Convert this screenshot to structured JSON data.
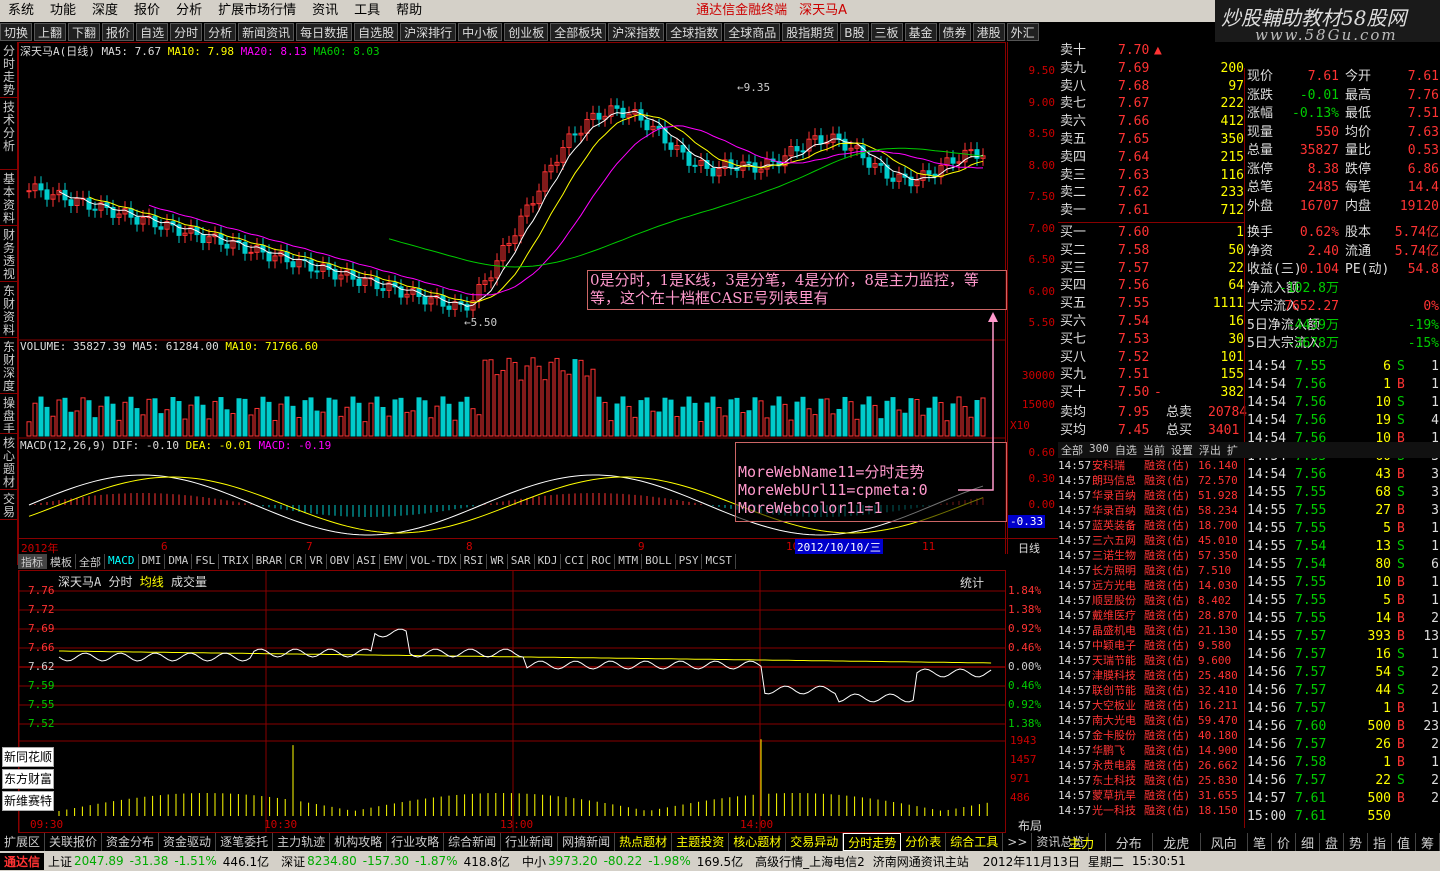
{
  "menu": [
    "系统",
    "功能",
    "深度",
    "报价",
    "分析",
    "扩展市场行情",
    "资讯",
    "工具",
    "帮助"
  ],
  "title_app": "通达信金融终端",
  "title_stock": "深天马A",
  "watermark": {
    "line1": "炒股輔助教材58股网",
    "line2": "www.58Gu.com"
  },
  "toolbar": [
    "切换",
    "上翻",
    "下翻",
    "报价",
    "自选",
    "分时",
    "分析",
    "新闻资讯",
    "每日数据",
    "自选股",
    "沪深排行",
    "中小板",
    "创业板",
    "全部板块",
    "沪深指数",
    "全球指数",
    "全球商品",
    "股指期货",
    "B股",
    "三板",
    "基金",
    "债券",
    "港股",
    "外汇"
  ],
  "vtabs": [
    "分时走势",
    "技术分析",
    "基本资料",
    "财务透视",
    "东财资料",
    "东财深度",
    "操盘手",
    "核心题材",
    "交易日"
  ],
  "kline": {
    "header_name": "深天马A(日线)",
    "ma5": "MA5: 7.67",
    "ma10": "MA10: 7.98",
    "ma20": "MA20: 8.13",
    "ma60": "MA60: 8.03",
    "high_label": "9.35",
    "low_label": "5.50",
    "price_axis": [
      "9.50",
      "9.00",
      "8.50",
      "8.00",
      "7.50",
      "7.00",
      "6.50",
      "6.00",
      "5.50"
    ],
    "vol_header": "VOLUME: 35827.39",
    "vol_ma5": "MA5: 61284.00",
    "vol_ma10": "MA10: 71766.60",
    "vol_axis": [
      "30000",
      "15000",
      "X10"
    ],
    "macd_header": "MACD(12,26,9)",
    "macd_dif": "DIF: -0.10",
    "macd_dea": "DEA: -0.01",
    "macd_val": "MACD: -0.19",
    "macd_axis": [
      "0.60",
      "0.30",
      "0.00",
      "-0.33"
    ],
    "date_axis": [
      "2012年",
      "6",
      "7",
      "8",
      "9",
      "10",
      "11"
    ],
    "date_cursor": "2012/10/10/三",
    "date_right": "日线"
  },
  "indicators": [
    "指标",
    "模板",
    "全部",
    "MACD",
    "DMI",
    "DMA",
    "FSL",
    "TRIX",
    "BRAR",
    "CR",
    "VR",
    "OBV",
    "ASI",
    "EMV",
    "VOL-TDX",
    "RSI",
    "WR",
    "SAR",
    "KDJ",
    "CCI",
    "ROC",
    "MTM",
    "BOLL",
    "PSY",
    "MCST"
  ],
  "annotation1": "0是分时，1是K线，3是分笔，4是分价，8是主力监控，等等，这个在十档框CASE号列表里有",
  "annotation2": [
    "MoreWebName11=分时走势",
    "MoreWebUrl11=cpmeta:0",
    "MoreWebcolor11=1"
  ],
  "intraday": {
    "header": "深天马A",
    "mode": "分时",
    "avg": "均线",
    "vol": "成交量",
    "stat": "统计",
    "price_axis": [
      "7.76",
      "7.72",
      "7.69",
      "7.66",
      "7.62",
      "7.59",
      "7.55",
      "7.52"
    ],
    "pct_axis": [
      "1.84%",
      "1.38%",
      "0.92%",
      "0.46%",
      "0.00%",
      "0.46%",
      "0.92%",
      "1.38%"
    ],
    "vol_axis": [
      "1943",
      "1457",
      "971",
      "486"
    ],
    "time_axis": [
      "09:30",
      "10:30",
      "13:00",
      "14:00"
    ],
    "layout": "布局",
    "side_buttons": [
      "新同花顺",
      "东方财富",
      "新维赛特"
    ]
  },
  "orderbook": {
    "sell": [
      [
        "卖十",
        "7.70",
        "▲",
        ""
      ],
      [
        "卖九",
        "7.69",
        "",
        "200"
      ],
      [
        "卖八",
        "7.68",
        "",
        "97"
      ],
      [
        "卖七",
        "7.67",
        "",
        "222"
      ],
      [
        "卖六",
        "7.66",
        "",
        "412"
      ],
      [
        "卖五",
        "7.65",
        "",
        "350"
      ],
      [
        "卖四",
        "7.64",
        "",
        "215"
      ],
      [
        "卖三",
        "7.63",
        "",
        "116"
      ],
      [
        "卖二",
        "7.62",
        "",
        "233"
      ],
      [
        "卖一",
        "7.61",
        "",
        "712"
      ]
    ],
    "buy": [
      [
        "买一",
        "7.60",
        "",
        "1"
      ],
      [
        "买二",
        "7.58",
        "",
        "50"
      ],
      [
        "买三",
        "7.57",
        "",
        "22"
      ],
      [
        "买四",
        "7.56",
        "",
        "64"
      ],
      [
        "买五",
        "7.55",
        "",
        "1111"
      ],
      [
        "买六",
        "7.54",
        "",
        "16"
      ],
      [
        "买七",
        "7.53",
        "",
        "30"
      ],
      [
        "买八",
        "7.52",
        "",
        "101"
      ],
      [
        "买九",
        "7.51",
        "",
        "155"
      ],
      [
        "买十",
        "7.50",
        "-",
        "382"
      ]
    ],
    "avg_sell": [
      "卖均",
      "7.95",
      "总卖",
      "20784"
    ],
    "avg_buy": [
      "买均",
      "7.45",
      "总买",
      "3401"
    ]
  },
  "stats": [
    [
      "现价",
      "7.61",
      "今开",
      "7.61"
    ],
    [
      "涨跌",
      "-0.01",
      "最高",
      "7.76"
    ],
    [
      "涨幅",
      "-0.13%",
      "最低",
      "7.51"
    ],
    [
      "现量",
      "550",
      "均价",
      "7.63"
    ],
    [
      "总量",
      "35827",
      "量比",
      "0.53"
    ],
    [
      "涨停",
      "8.38",
      "跌停",
      "6.86"
    ],
    [
      "总笔",
      "2485",
      "每笔",
      "14.4"
    ],
    [
      "外盘",
      "16707",
      "内盘",
      "19120"
    ],
    [
      "换手",
      "0.62%",
      "股本",
      "5.74亿"
    ],
    [
      "净资",
      "2.40",
      "流通",
      "5.74亿"
    ],
    [
      "收益(三)",
      "0.104",
      "PE(动)",
      "54.8"
    ],
    [
      "净流入额",
      "-102.8万",
      "",
      ""
    ],
    [
      "大宗流入",
      "7652.27",
      "",
      "0%"
    ],
    [
      "5日净流入额",
      "-4439万",
      "",
      "-19%"
    ],
    [
      "5日大宗流入",
      "-3678万",
      "",
      "-15%"
    ]
  ],
  "ticks": [
    [
      "14:54",
      "7.55",
      "6",
      "S",
      "1"
    ],
    [
      "14:54",
      "7.56",
      "1",
      "B",
      "1"
    ],
    [
      "14:54",
      "7.56",
      "10",
      "S",
      "1"
    ],
    [
      "14:54",
      "7.56",
      "19",
      "S",
      "4"
    ],
    [
      "14:54",
      "7.56",
      "10",
      "B",
      "1"
    ],
    [
      "14:54",
      "7.55",
      "60",
      "S",
      "3"
    ],
    [
      "14:54",
      "7.56",
      "43",
      "B",
      "3"
    ],
    [
      "14:55",
      "7.55",
      "68",
      "S",
      "3"
    ],
    [
      "14:55",
      "7.55",
      "27",
      "B",
      "3"
    ],
    [
      "14:55",
      "7.55",
      "5",
      "B",
      "1"
    ],
    [
      "14:55",
      "7.54",
      "13",
      "S",
      "1"
    ],
    [
      "14:55",
      "7.54",
      "80",
      "S",
      "6"
    ],
    [
      "14:55",
      "7.55",
      "10",
      "B",
      "1"
    ],
    [
      "14:55",
      "7.55",
      "5",
      "B",
      "1"
    ],
    [
      "14:55",
      "7.55",
      "14",
      "B",
      "2"
    ],
    [
      "14:55",
      "7.57",
      "393",
      "B",
      "13"
    ],
    [
      "14:56",
      "7.57",
      "16",
      "S",
      "1"
    ],
    [
      "14:56",
      "7.57",
      "54",
      "S",
      "2"
    ],
    [
      "14:56",
      "7.57",
      "44",
      "S",
      "2"
    ],
    [
      "14:56",
      "7.57",
      "1",
      "B",
      "1"
    ],
    [
      "14:56",
      "7.60",
      "500",
      "B",
      "23"
    ],
    [
      "14:56",
      "7.57",
      "26",
      "B",
      "2"
    ],
    [
      "14:56",
      "7.58",
      "1",
      "B",
      "1"
    ],
    [
      "14:56",
      "7.57",
      "22",
      "S",
      "2"
    ],
    [
      "14:57",
      "7.61",
      "500",
      "B",
      "2"
    ],
    [
      "15:00",
      "7.61",
      "550",
      "",
      ""
    ]
  ],
  "ticktabs": [
    "全部",
    "300",
    "自选",
    "当前",
    "设置",
    "浮出",
    "扩"
  ],
  "news": [
    [
      "14:57",
      "安科瑞",
      "融资(估)",
      "16.140"
    ],
    [
      "14:57",
      "朗玛信息",
      "融资(估)",
      "72.570"
    ],
    [
      "14:57",
      "华录百纳",
      "融资(估)",
      "51.928"
    ],
    [
      "14:57",
      "华录百纳",
      "融资(估)",
      "58.234"
    ],
    [
      "14:57",
      "蓝英装备",
      "融资(估)",
      "18.700"
    ],
    [
      "14:57",
      "三六五网",
      "融资(估)",
      "45.010"
    ],
    [
      "14:57",
      "三诺生物",
      "融资(估)",
      "57.350"
    ],
    [
      "14:57",
      "长方照明",
      "融资(估)",
      "7.510"
    ],
    [
      "14:57",
      "远方光电",
      "融资(估)",
      "14.030"
    ],
    [
      "14:57",
      "顺昱股份",
      "融资(估)",
      "8.402"
    ],
    [
      "14:57",
      "戴维医疗",
      "融资(估)",
      "28.870"
    ],
    [
      "14:57",
      "晶盛机电",
      "融资(估)",
      "21.130"
    ],
    [
      "14:57",
      "中颖电子",
      "融资(估)",
      "9.580"
    ],
    [
      "14:57",
      "天瑞节能",
      "融资(估)",
      "9.600"
    ],
    [
      "14:57",
      "津膜科技",
      "融资(估)",
      "25.480"
    ],
    [
      "14:57",
      "联创节能",
      "融资(估)",
      "32.410"
    ],
    [
      "14:57",
      "大空板业",
      "融资(估)",
      "16.211"
    ],
    [
      "14:57",
      "南大光电",
      "融资(估)",
      "59.470"
    ],
    [
      "14:57",
      "金卡股份",
      "融资(估)",
      "40.180"
    ],
    [
      "14:57",
      "华鹏飞",
      "融资(估)",
      "14.900"
    ],
    [
      "14:57",
      "永贵电器",
      "融资(估)",
      "26.662"
    ],
    [
      "14:57",
      "东土科技",
      "融资(估)",
      "25.830"
    ],
    [
      "14:57",
      "蒙草抗旱",
      "融资(估)",
      "31.655"
    ],
    [
      "14:57",
      "光一科技",
      "融资(估)",
      "18.150"
    ]
  ],
  "botnav": [
    "扩展区",
    "关联报价",
    "资金分布",
    "资金驱动",
    "逐笔委托",
    "主力轨迹",
    "机构攻略",
    "行业攻略",
    "综合新闻",
    "行业新闻",
    "网摘新闻",
    "热点题材",
    "主题投资",
    "核心题材",
    "交易异动",
    "分时走势",
    "分价表",
    "综合工具",
    ">>",
    "资讯总览"
  ],
  "rightbot": [
    "主力",
    "分布",
    "龙虎",
    "风向"
  ],
  "righttabs": [
    "笔",
    "价",
    "细",
    "盘",
    "势",
    "指",
    "值",
    "筹"
  ],
  "status": {
    "logo": "通达信",
    "sh": "上证",
    "sh_val": "2047.89",
    "sh_chg": "-31.38",
    "sh_pct": "-1.51%",
    "sh_amt": "446.1亿",
    "sz": "深证",
    "sz_val": "8234.80",
    "sz_chg": "-157.30",
    "sz_pct": "-1.87%",
    "sz_amt": "418.8亿",
    "zx": "中小",
    "zx_val": "3973.20",
    "zx_chg": "-80.22",
    "zx_pct": "-1.98%",
    "zx_amt": "169.5亿",
    "net": "高级行情_上海电信2",
    "site": "济南网通资讯主站",
    "date": "2012年11月13日",
    "weekday": "星期二",
    "time": "15:30:51"
  },
  "colors": {
    "up": "#ff3333",
    "down": "#00cccc",
    "grid": "#880000",
    "ma5": "#ffffff",
    "ma10": "#ffff00",
    "ma20": "#ff00ff",
    "ma60": "#00cc00"
  }
}
